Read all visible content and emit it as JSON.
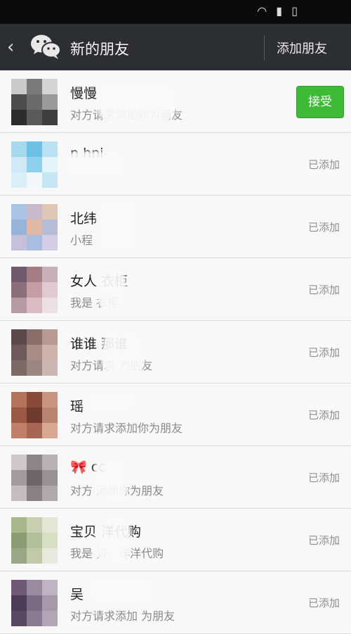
{
  "header": {
    "back_icon": "‹",
    "title": "新的朋友",
    "add_friend_label": "添加朋友"
  },
  "items": [
    {
      "name": "慢慢",
      "sub": "对方请求添加你为朋友",
      "status": "",
      "button": "接受",
      "avatar": [
        "#c9c9c9",
        "#7a7a7a",
        "#d4d4d4",
        "#4c4c4c",
        "#6b6b6b",
        "#9a9a9a",
        "#2c2c2c",
        "#5a5a5a",
        "#3e3e3e"
      ]
    },
    {
      "name": "n       hni",
      "sub": "",
      "status": "已添加",
      "button": "",
      "avatar": [
        "#a6d8ee",
        "#6cc1e6",
        "#b9e2f3",
        "#cfeaf6",
        "#8fd0ee",
        "#e3f3fa",
        "#d9eff8",
        "#f1f8fb",
        "#c7e6f4"
      ]
    },
    {
      "name": "北纬",
      "sub": "小程",
      "status": "已添加",
      "button": "",
      "avatar": [
        "#a9c4e6",
        "#c8b9c8",
        "#dfc7b5",
        "#96b3d9",
        "#e0b9a4",
        "#b4bcd8",
        "#c7c0dd",
        "#a9bde0",
        "#d5cde4"
      ]
    },
    {
      "name": "女人 衣柜",
      "sub": "我是 衣柜",
      "status": "已添加",
      "button": "",
      "avatar": [
        "#6e5c6e",
        "#a37f85",
        "#c8b0b8",
        "#8d6f7c",
        "#c49ea4",
        "#e0c9cf",
        "#b69aa6",
        "#d8bcc2",
        "#ede0e4"
      ]
    },
    {
      "name": "谁谁 那谁",
      "sub": "对方请求 为朋友",
      "status": "已添加",
      "button": "",
      "avatar": [
        "#5a4a4a",
        "#8b6e6a",
        "#b89a92",
        "#6e5a5a",
        "#a88c84",
        "#cdb3aa",
        "#7b6a66",
        "#9a8780",
        "#c9b6ae"
      ]
    },
    {
      "name": "瑶",
      "sub": "对方请求添加你为朋友",
      "status": "已添加",
      "button": "",
      "avatar": [
        "#b5735a",
        "#8a4a3a",
        "#c99580",
        "#9c5a46",
        "#6e3a2e",
        "#b98470",
        "#c27f68",
        "#a66654",
        "#d8a892"
      ]
    },
    {
      "name": "🎀      cc",
      "sub": "对方 添加你为朋友",
      "status": "已添加",
      "button": "",
      "avatar": [
        "#d0c8c8",
        "#8c8488",
        "#b9b0b4",
        "#a49a9e",
        "#6e666a",
        "#9a9094",
        "#c4bcbe",
        "#8a8084",
        "#b0a8ac"
      ]
    },
    {
      "name": "宝贝 洋代购",
      "sub": "我是 贝，洋洋代购",
      "status": "已添加",
      "button": "",
      "avatar": [
        "#a6b88a",
        "#c6d0b0",
        "#e2e6d4",
        "#8a9c74",
        "#b2c09a",
        "#d6dec4",
        "#98a886",
        "#c0caa8",
        "#e6eadc"
      ]
    },
    {
      "name": "吴",
      "sub": "对方请求添加 为朋友",
      "status": "已添加",
      "button": "",
      "avatar": [
        "#6e5a74",
        "#9a8a9e",
        "#c0b4c4",
        "#4e3c56",
        "#7c6a82",
        "#a898ac",
        "#5a4862",
        "#8c7a90",
        "#b4a4b8"
      ]
    }
  ]
}
